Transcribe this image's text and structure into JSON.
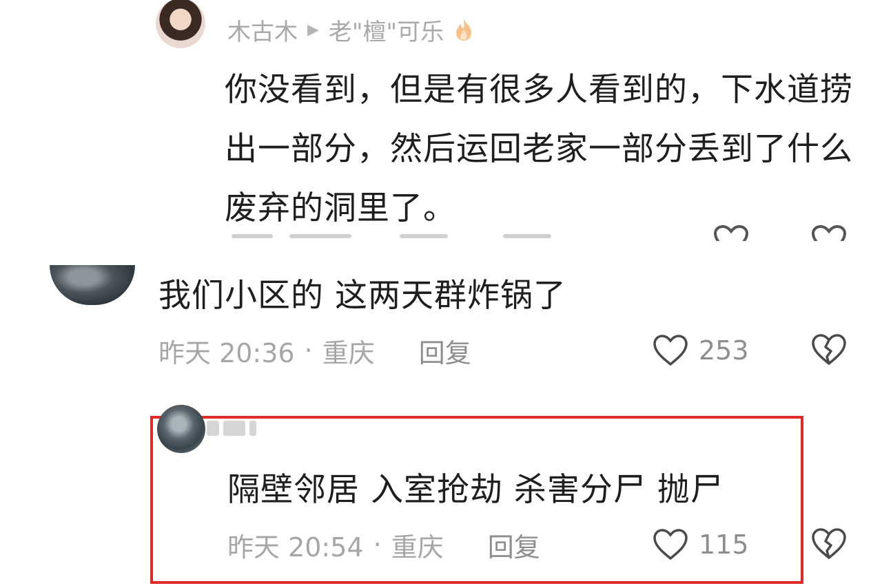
{
  "comment_reply_top": {
    "username": "木古木",
    "reply_to": "老\"檀\"可乐",
    "text": "你没看到，但是有很多人看到的，下水道捞出一部分，然后运回老家一部分丢到了什么废弃的洞里了。"
  },
  "comment_main": {
    "text": "我们小区的 这两天群炸锅了",
    "time": "昨天 20:36",
    "separator": "·",
    "location": "重庆",
    "reply_label": "回复",
    "likes": "253"
  },
  "comment_highlighted": {
    "text": "隔壁邻居 入室抢劫 杀害分尸 抛尸",
    "time": "昨天 20:54",
    "separator": "·",
    "location": "重庆",
    "reply_label": "回复",
    "likes": "115"
  },
  "colors": {
    "highlight_border": "#e02a2a",
    "meta_text": "#a6a6a6",
    "body_text": "#1e1e1e",
    "flame": "#f5a35c"
  },
  "icons": {
    "like": "heart-outline-icon",
    "dislike": "broken-heart-icon",
    "play": "play-triangle-icon",
    "flame": "fire-icon"
  }
}
